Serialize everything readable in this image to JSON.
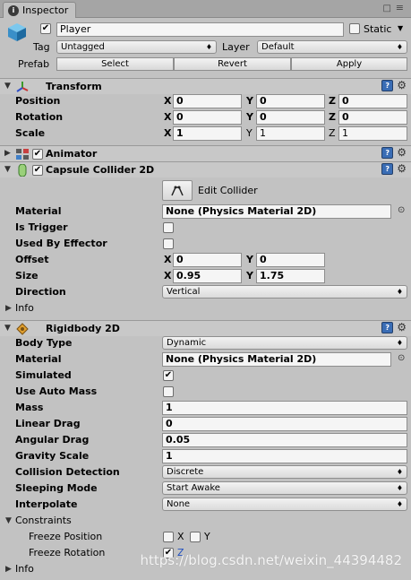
{
  "window": {
    "tab_title": "Inspector",
    "lock_icon": "lock-icon",
    "menu_icon": "menu-icon"
  },
  "gameobject": {
    "name": "Player",
    "static_label": "Static",
    "tag_label": "Tag",
    "tag_value": "Untagged",
    "layer_label": "Layer",
    "layer_value": "Default",
    "prefab_label": "Prefab",
    "prefab_select": "Select",
    "prefab_revert": "Revert",
    "prefab_apply": "Apply"
  },
  "transform": {
    "title": "Transform",
    "position": {
      "label": "Position",
      "x": "0",
      "y": "0",
      "z": "0"
    },
    "rotation": {
      "label": "Rotation",
      "x": "0",
      "y": "0",
      "z": "0"
    },
    "scale": {
      "label": "Scale",
      "x": "1",
      "y": "1",
      "z": "1"
    },
    "axis_x": "X",
    "axis_y": "Y",
    "axis_z": "Z"
  },
  "animator": {
    "title": "Animator"
  },
  "capsule": {
    "title": "Capsule Collider 2D",
    "edit_collider": "Edit Collider",
    "material_label": "Material",
    "material_value": "None (Physics Material 2D)",
    "is_trigger_label": "Is Trigger",
    "used_by_effector_label": "Used By Effector",
    "offset_label": "Offset",
    "offset_x": "0",
    "offset_y": "0",
    "size_label": "Size",
    "size_x": "0.95",
    "size_y": "1.75",
    "direction_label": "Direction",
    "direction_value": "Vertical",
    "info_label": "Info"
  },
  "rigidbody": {
    "title": "Rigidbody 2D",
    "body_type_label": "Body Type",
    "body_type_value": "Dynamic",
    "material_label": "Material",
    "material_value": "None (Physics Material 2D)",
    "simulated_label": "Simulated",
    "simulated_checked": true,
    "use_auto_mass_label": "Use Auto Mass",
    "mass_label": "Mass",
    "mass_value": "1",
    "linear_drag_label": "Linear Drag",
    "linear_drag_value": "0",
    "angular_drag_label": "Angular Drag",
    "angular_drag_value": "0.05",
    "gravity_scale_label": "Gravity Scale",
    "gravity_scale_value": "1",
    "collision_detection_label": "Collision Detection",
    "collision_detection_value": "Discrete",
    "sleeping_mode_label": "Sleeping Mode",
    "sleeping_mode_value": "Start Awake",
    "interpolate_label": "Interpolate",
    "interpolate_value": "None",
    "constraints_label": "Constraints",
    "freeze_position_label": "Freeze Position",
    "freeze_position_x": "X",
    "freeze_position_y": "Y",
    "freeze_rotation_label": "Freeze Rotation",
    "freeze_rotation_z": "Z",
    "info_label": "Info"
  },
  "watermark": "https://blog.csdn.net/weixin_44394482",
  "colors": {
    "panel": "#c2c2c2",
    "header": "#c8c8c8",
    "field": "#f5f5f5",
    "help_icon": "#3a6db5"
  }
}
